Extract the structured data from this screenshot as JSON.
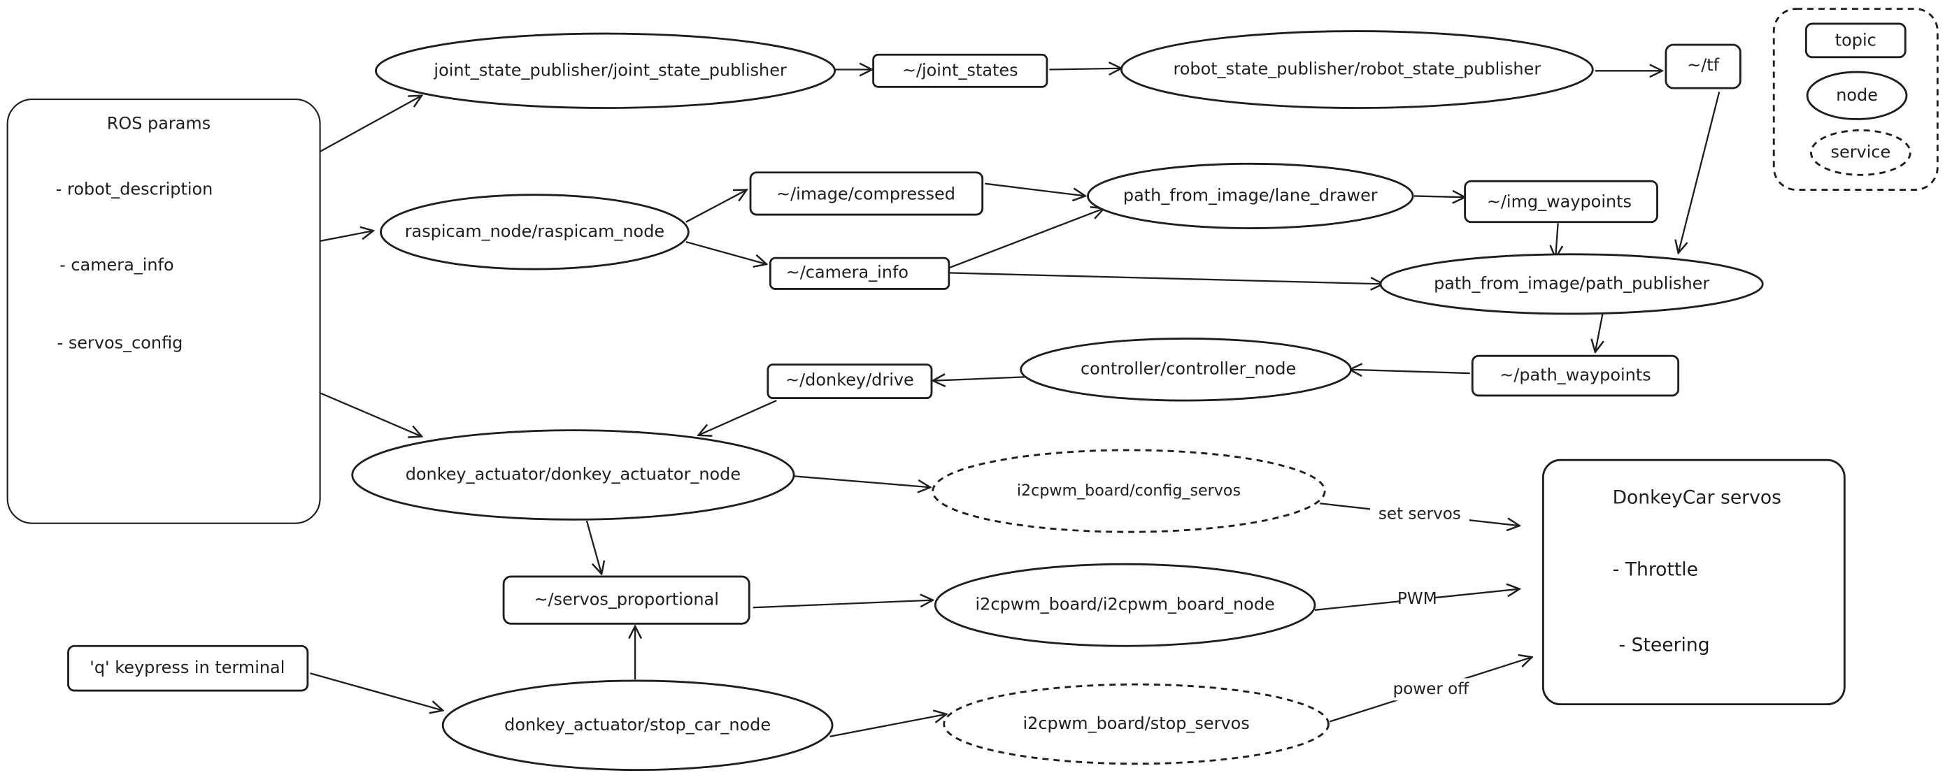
{
  "legend": {
    "topic": "topic",
    "node": "node",
    "service": "service"
  },
  "params": {
    "title": "ROS params",
    "items": [
      "- robot_description",
      "- camera_info",
      "- servos_config"
    ]
  },
  "nodes": {
    "jsp": "joint_state_publisher/joint_state_publisher",
    "rsp": "robot_state_publisher/robot_state_publisher",
    "raspicam": "raspicam_node/raspicam_node",
    "lane_drawer": "path_from_image/lane_drawer",
    "path_publisher": "path_from_image/path_publisher",
    "controller": "controller/controller_node",
    "actuator": "donkey_actuator/donkey_actuator_node",
    "i2cpwm": "i2cpwm_board/i2cpwm_board_node",
    "stop_car": "donkey_actuator/stop_car_node"
  },
  "services": {
    "config_servos": "i2cpwm_board/config_servos",
    "stop_servos": "i2cpwm_board/stop_servos"
  },
  "topics": {
    "joint_states": "~/joint_states",
    "tf": "~/tf",
    "image_compressed": "~/image/compressed",
    "camera_info": "~/camera_info",
    "img_waypoints": "~/img_waypoints",
    "path_waypoints": "~/path_waypoints",
    "donkey_drive": "~/donkey/drive",
    "servos_proportional": "~/servos_proportional"
  },
  "keypress": "'q' keypress in terminal",
  "servos_box": {
    "title": "DonkeyCar servos",
    "items": [
      "- Throttle",
      "- Steering"
    ]
  },
  "edges": [
    {
      "from": "robot_description",
      "to": "jsp"
    },
    {
      "from": "jsp",
      "to": "joint_states"
    },
    {
      "from": "joint_states",
      "to": "rsp"
    },
    {
      "from": "rsp",
      "to": "tf"
    },
    {
      "from": "camera_info_param",
      "to": "raspicam"
    },
    {
      "from": "raspicam",
      "to": "image_compressed"
    },
    {
      "from": "raspicam",
      "to": "camera_info"
    },
    {
      "from": "image_compressed",
      "to": "lane_drawer"
    },
    {
      "from": "camera_info",
      "to": "lane_drawer"
    },
    {
      "from": "camera_info",
      "to": "path_publisher"
    },
    {
      "from": "lane_drawer",
      "to": "img_waypoints"
    },
    {
      "from": "img_waypoints",
      "to": "path_publisher"
    },
    {
      "from": "tf",
      "to": "path_publisher"
    },
    {
      "from": "path_publisher",
      "to": "path_waypoints"
    },
    {
      "from": "path_waypoints",
      "to": "controller"
    },
    {
      "from": "controller",
      "to": "donkey_drive"
    },
    {
      "from": "donkey_drive",
      "to": "actuator"
    },
    {
      "from": "servos_config",
      "to": "actuator"
    },
    {
      "from": "actuator",
      "to": "config_servos"
    },
    {
      "from": "actuator",
      "to": "servos_proportional"
    },
    {
      "from": "config_servos",
      "to": "servos_box",
      "label": "set servos"
    },
    {
      "from": "servos_proportional",
      "to": "i2cpwm"
    },
    {
      "from": "i2cpwm",
      "to": "servos_box",
      "label": "PWM"
    },
    {
      "from": "keypress",
      "to": "stop_car"
    },
    {
      "from": "stop_car",
      "to": "servos_proportional"
    },
    {
      "from": "stop_car",
      "to": "stop_servos"
    },
    {
      "from": "stop_servos",
      "to": "servos_box",
      "label": "power off"
    }
  ]
}
